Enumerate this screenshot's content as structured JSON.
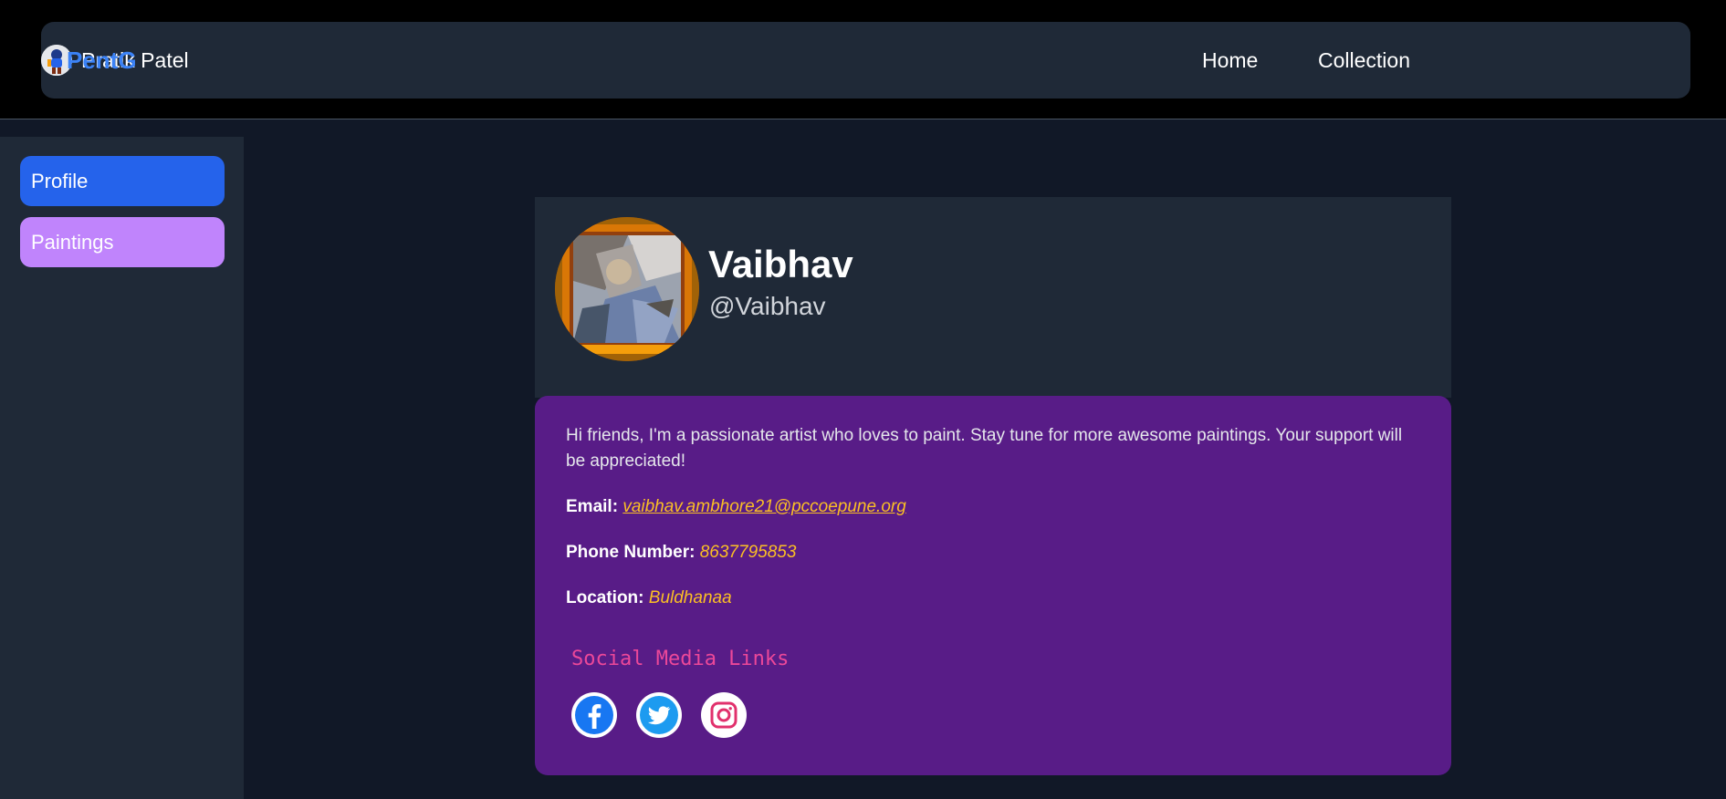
{
  "navbar": {
    "brand": "PentG",
    "links": [
      {
        "label": "Home"
      },
      {
        "label": "Collection"
      }
    ],
    "user": {
      "name": "Pratik Patel",
      "avatar_icon": "user-avatar-icon"
    }
  },
  "sidebar": {
    "items": [
      {
        "label": "Profile",
        "color": "#2563eb"
      },
      {
        "label": "Paintings",
        "color": "#c084fc"
      }
    ]
  },
  "profile": {
    "name": "Vaibhav",
    "handle": "@Vaibhav",
    "bio": "Hi friends, I'm a passionate artist who loves to paint. Stay tune for more awesome paintings. Your support will be appreciated!",
    "email_label": "Email:",
    "email": "vaibhav.ambhore21@pccoepune.org",
    "phone_label": "Phone Number:",
    "phone": "8637795853",
    "location_label": "Location:",
    "location": "Buldhanaa",
    "social_title": "Social Media Links",
    "social": [
      {
        "icon": "facebook-icon",
        "color": "#1877f2"
      },
      {
        "icon": "twitter-icon",
        "color": "#1d9bf0"
      },
      {
        "icon": "instagram-icon",
        "color": "#e1306c"
      }
    ]
  },
  "colors": {
    "accent": "#3b82f6",
    "card_body": "#581c87",
    "highlight": "#fbbf24",
    "social_title": "#ec4899"
  }
}
